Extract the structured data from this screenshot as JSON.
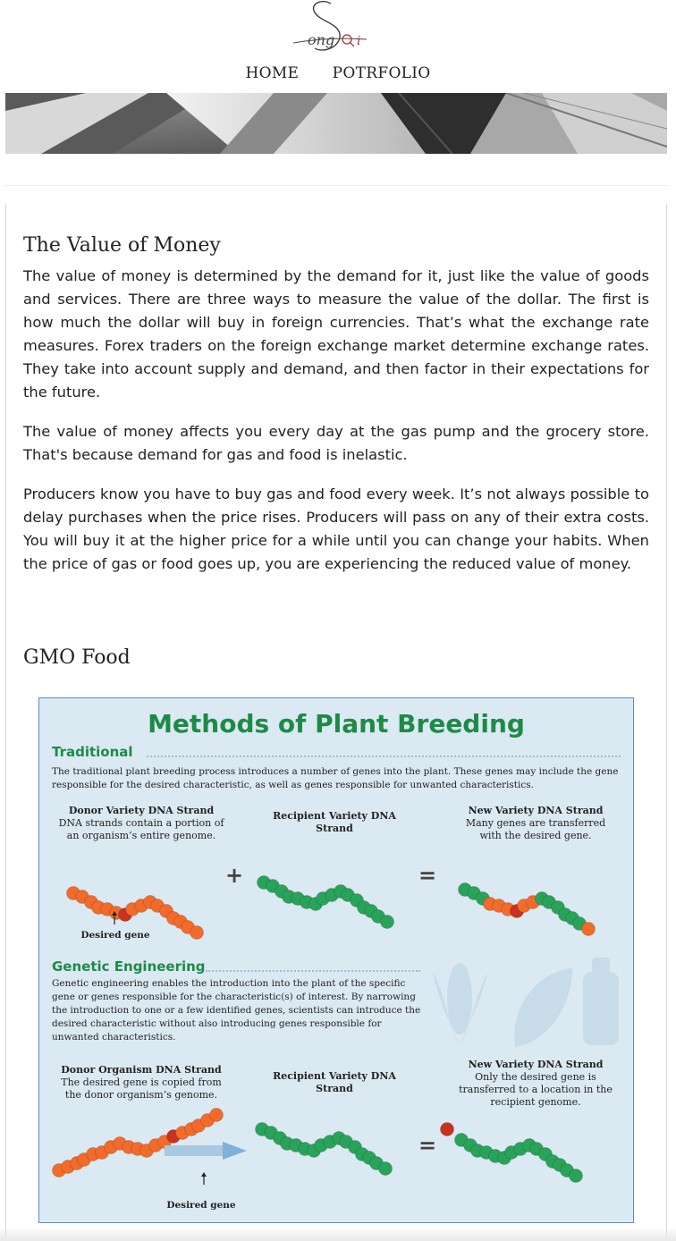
{
  "header": {
    "logo_text": "SongQi",
    "nav": [
      {
        "label": "HOME"
      },
      {
        "label": "POTRFOLIO"
      }
    ]
  },
  "article": {
    "section1_title": "The Value of Money",
    "paragraphs": [
      "The value of money is determined by the demand for it, just like the value of goods and services. There are three ways to measure the value of the dollar. The first is how much the dollar will buy in foreign currencies. That’s what the exchange rate measures. Forex traders on the foreign exchange market determine exchange rates. They take into account supply and demand, and then factor in their expectations for the future.",
      "The value of money affects you every day at the gas pump and the grocery store. That's because demand for gas and food is inelastic.",
      "Producers know you have to buy gas and food every week. It’s not always possible to delay purchases when the price rises. Producers will pass on any of their extra costs. You will buy it at the higher price for a while until you can change your habits. When the price of gas or food goes up, you are experiencing the reduced value of money."
    ],
    "section2_title": "GMO Food"
  },
  "infographic": {
    "title": "Methods of Plant Breeding",
    "traditional": {
      "heading": "Traditional",
      "text": "The traditional plant breeding process introduces a number of genes into the plant. These genes may include the gene responsible for the desired characteristic, as well as genes responsible for unwanted characteristics.",
      "donor_title": "Donor Variety DNA Strand",
      "donor_text": "DNA strands contain a portion of an organism’s entire genome.",
      "recipient_title": "Recipient Variety DNA Strand",
      "new_title": "New Variety DNA Strand",
      "new_text": "Many genes are transferred with the desired gene.",
      "desired_gene": "Desired gene",
      "plus": "+",
      "equals": "="
    },
    "genetic": {
      "heading": "Genetic Engineering",
      "text": "Genetic engineering enables the introduction into the plant of the specific gene or genes responsible for the characteristic(s) of interest. By narrowing the introduction to one or a few identified genes, scientists can introduce the desired characteristic without also introducing genes responsible for unwanted characteristics.",
      "donor_title": "Donor Organism DNA Strand",
      "donor_text": "The desired gene is copied from the donor organism’s genome.",
      "recipient_title": "Recipient Variety DNA Strand",
      "new_title": "New Variety DNA Strand",
      "new_text": "Only the desired gene is transferred to a location in the recipient genome.",
      "desired_gene": "Desired gene",
      "equals": "="
    },
    "colors": {
      "green_title": "#1e8a48",
      "orange_bead": "#f26b2a",
      "green_bead": "#2aa35a",
      "red_gene": "#c8321e",
      "background": "#dbe9f2"
    }
  }
}
